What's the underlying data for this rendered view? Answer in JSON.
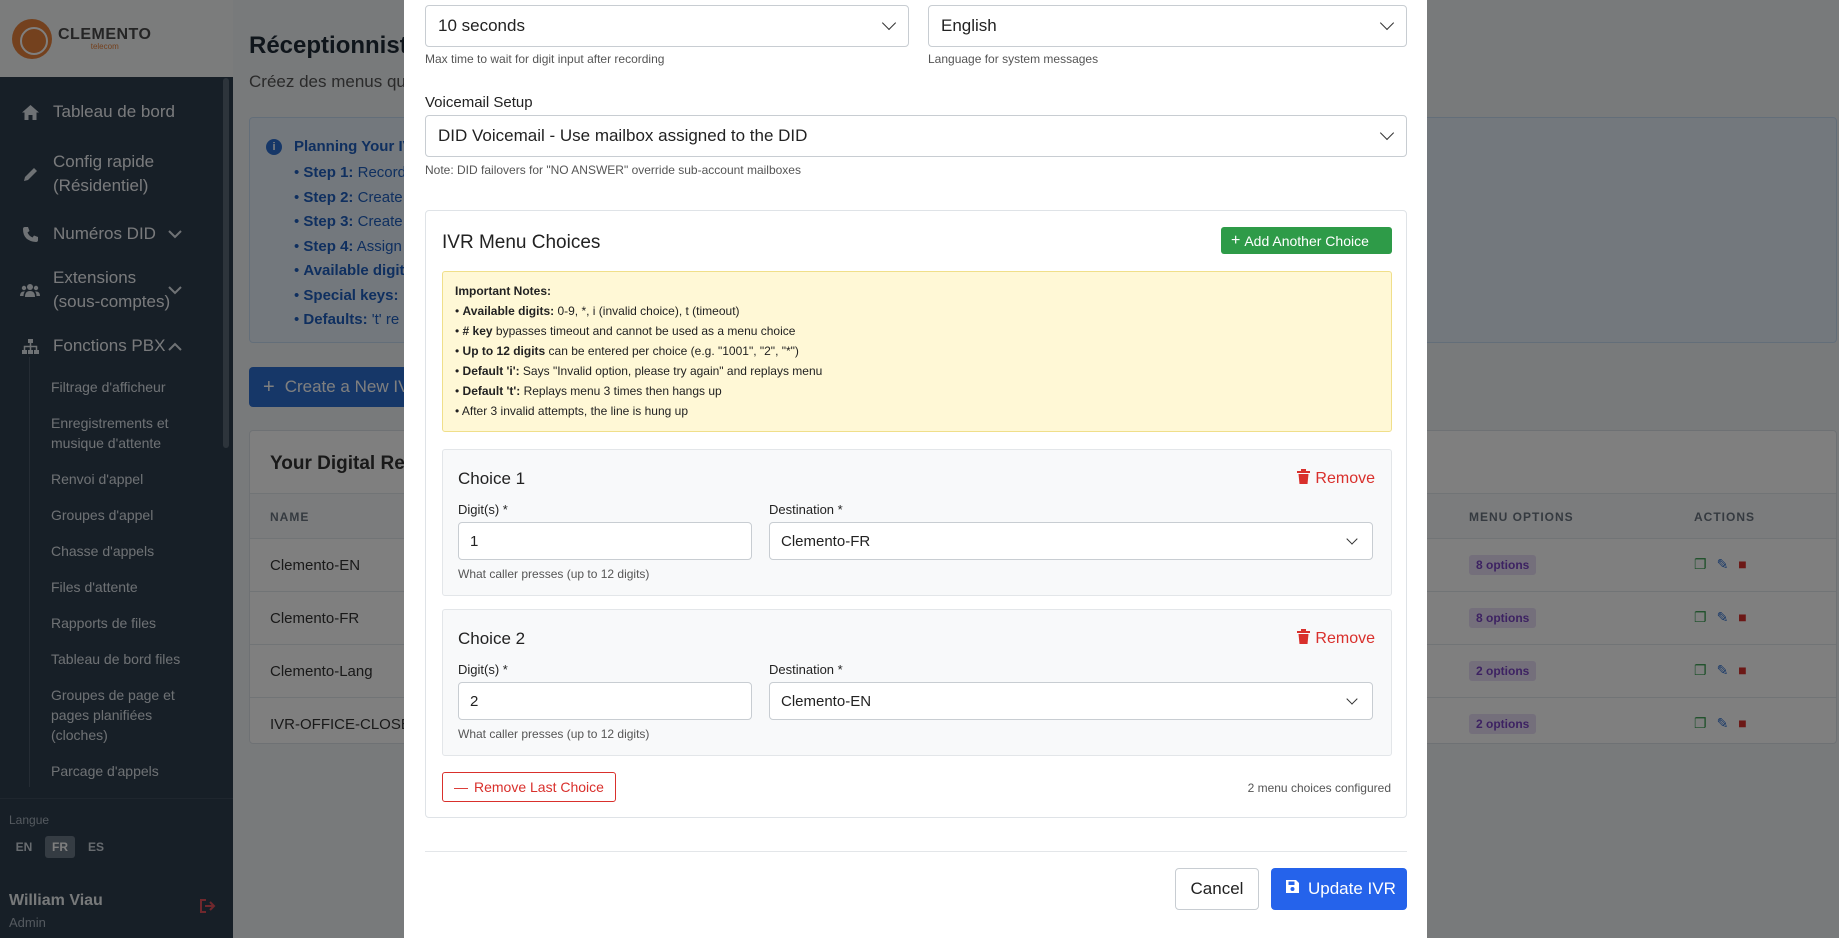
{
  "sidebar": {
    "brand": "CLEMENTO",
    "brand_sub": "telecom",
    "nav": [
      {
        "label": "Tableau de bord"
      },
      {
        "label": "Config rapide (Résidentiel)"
      },
      {
        "label": "Numéros DID"
      },
      {
        "label": "Extensions (sous-comptes)"
      },
      {
        "label": "Fonctions PBX"
      }
    ],
    "sub_items": [
      "Filtrage d'afficheur",
      "Enregistrements et musique d'attente",
      "Renvoi d'appel",
      "Groupes d'appel",
      "Chasse d'appels",
      "Files d'attente",
      "Rapports de files",
      "Tableau de bord files",
      "Groupes de page et pages planifiées (cloches)",
      "Parcage d'appels"
    ],
    "language_label": "Langue",
    "languages": [
      "EN",
      "FR",
      "ES"
    ],
    "active_language": "FR",
    "user_name": "William Viau",
    "user_role": "Admin"
  },
  "background": {
    "title": "Réceptionnist",
    "subtitle": "Créez des menus qui",
    "info_title": "Planning Your IVI",
    "info_items": [
      {
        "bold": "Step 1:",
        "text": " Record"
      },
      {
        "bold": "Step 2:",
        "text": " Create"
      },
      {
        "bold": "Step 3:",
        "text": " Create"
      },
      {
        "bold": "Step 4:",
        "text": " Assign"
      },
      {
        "bold": "Available digit",
        "text": ""
      },
      {
        "bold": "Special keys:",
        "text": " "
      },
      {
        "bold": "Defaults:",
        "text": " 't' re"
      }
    ],
    "create_button": "Create a New IV",
    "table_title": "Your Digital Rec",
    "columns": {
      "name": "NAME",
      "menu_options": "MENU OPTIONS",
      "actions": "ACTIONS"
    },
    "rows": [
      {
        "name": "Clemento-EN",
        "options": "8 options"
      },
      {
        "name": "Clemento-FR",
        "options": "8 options"
      },
      {
        "name": "Clemento-Lang",
        "options": "2 options"
      },
      {
        "name": "IVR-OFFICE-CLOSE",
        "options": "2 options"
      }
    ]
  },
  "modal": {
    "timeout_value": "10 seconds",
    "timeout_help": "Max time to wait for digit input after recording",
    "language_value": "English",
    "language_help": "Language for system messages",
    "voicemail_label": "Voicemail Setup",
    "voicemail_value": "DID Voicemail - Use mailbox assigned to the DID",
    "voicemail_note": "Note: DID failovers for \"NO ANSWER\" override sub-account mailboxes",
    "choices_title": "IVR Menu Choices",
    "add_choice_button": "Add Another Choice",
    "notes_title": "Important Notes:",
    "notes": [
      {
        "bold": "Available digits:",
        "text": " 0-9, *, i (invalid choice), t (timeout)"
      },
      {
        "bold": "# key",
        "text": " bypasses timeout and cannot be used as a menu choice"
      },
      {
        "bold": "Up to 12 digits",
        "text": " can be entered per choice (e.g. \"1001\", \"2\", \"*\")"
      },
      {
        "bold": "Default 'i':",
        "text": " Says \"Invalid option, please try again\" and replays menu"
      },
      {
        "bold": "Default 't':",
        "text": " Replays menu 3 times then hangs up"
      },
      {
        "bold": "",
        "text": "After 3 invalid attempts, the line is hung up"
      }
    ],
    "choices": [
      {
        "title": "Choice 1",
        "remove": "Remove",
        "digits_label": "Digit(s) *",
        "digits": "1",
        "dest_label": "Destination *",
        "destination": "Clemento-FR",
        "help": "What caller presses (up to 12 digits)"
      },
      {
        "title": "Choice 2",
        "remove": "Remove",
        "digits_label": "Digit(s) *",
        "digits": "2",
        "dest_label": "Destination *",
        "destination": "Clemento-EN",
        "help": "What caller presses (up to 12 digits)"
      }
    ],
    "remove_last_button": "Remove Last Choice",
    "count_text": "2 menu choices configured",
    "cancel_button": "Cancel",
    "update_button": "Update IVR"
  }
}
